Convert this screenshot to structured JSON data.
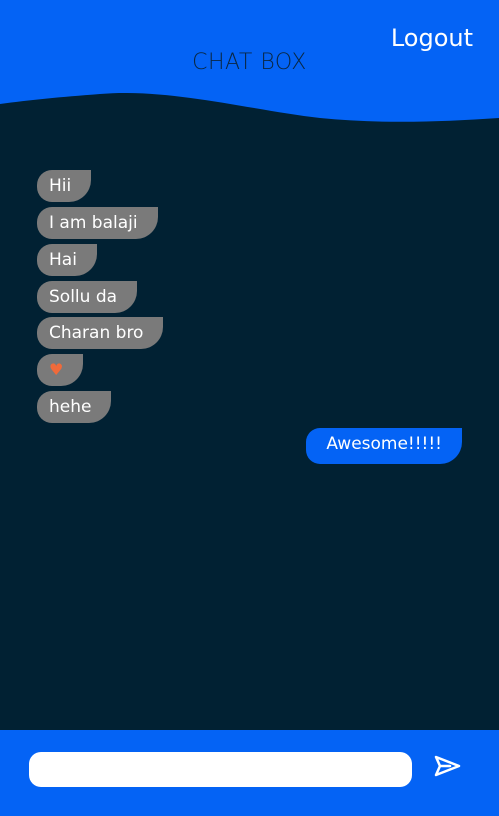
{
  "header": {
    "title": "CHAT BOX",
    "logout_label": "Logout"
  },
  "messages": [
    {
      "side": "left",
      "text": "Hii"
    },
    {
      "side": "left",
      "text": "I am balaji"
    },
    {
      "side": "left",
      "text": "Hai"
    },
    {
      "side": "left",
      "text": "Sollu da"
    },
    {
      "side": "left",
      "text": "Charan bro"
    },
    {
      "side": "left",
      "text": "♥",
      "emoji": "orange-heart-icon"
    },
    {
      "side": "left",
      "text": "hehe"
    },
    {
      "side": "right",
      "text": "Awesome!!!!!"
    }
  ],
  "composer": {
    "value": "",
    "placeholder": "",
    "send_icon": "send-icon"
  },
  "colors": {
    "background": "#012133",
    "accent": "#0463f5",
    "received_bubble": "#7a7a7a"
  }
}
